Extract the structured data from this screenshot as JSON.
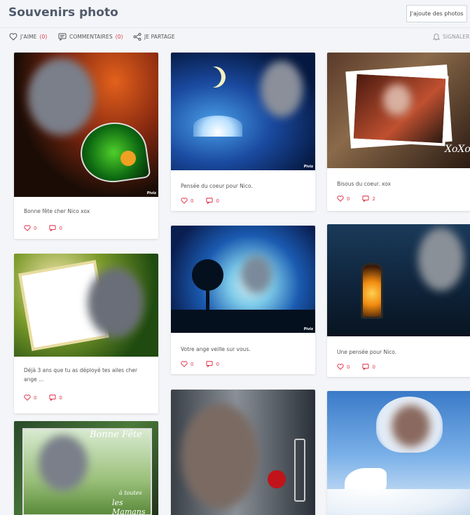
{
  "header": {
    "title": "Souvenirs photo",
    "add_button": "J'ajoute des photos"
  },
  "actions": {
    "like_label": "J'AIME",
    "like_count": "(0)",
    "comments_label": "COMMENTAIRES",
    "comments_count": "(0)",
    "share_label": "JE PARTAGE",
    "report_label": "SIGNALER"
  },
  "photos": [
    {
      "caption": "Bonne fête cher Nico xox",
      "likes": "0",
      "comments": "0",
      "watermark": "Piviz"
    },
    {
      "caption": "Pensée du coeur pour Nico.",
      "likes": "0",
      "comments": "0",
      "watermark": "Piviz"
    },
    {
      "caption": "Bisous du coeur. xox",
      "likes": "0",
      "comments": "2",
      "overlay_text": "XoXo"
    },
    {
      "caption": "Déjà 3 ans que tu as déployé tes ailes cher ange ...",
      "likes": "0",
      "comments": "0"
    },
    {
      "caption": "Votre ange veille sur vous.",
      "likes": "0",
      "comments": "0",
      "watermark": "Piviz"
    },
    {
      "caption": "Une pensée pour Nico.",
      "likes": "0",
      "comments": "0"
    },
    {
      "overlay_line1": "Bonne Fête",
      "overlay_line2": "à toutes",
      "overlay_line3": "les Mamans"
    },
    {},
    {}
  ],
  "colors": {
    "accent": "#e0394f",
    "title": "#505a6b",
    "background": "#f4f5f8"
  }
}
